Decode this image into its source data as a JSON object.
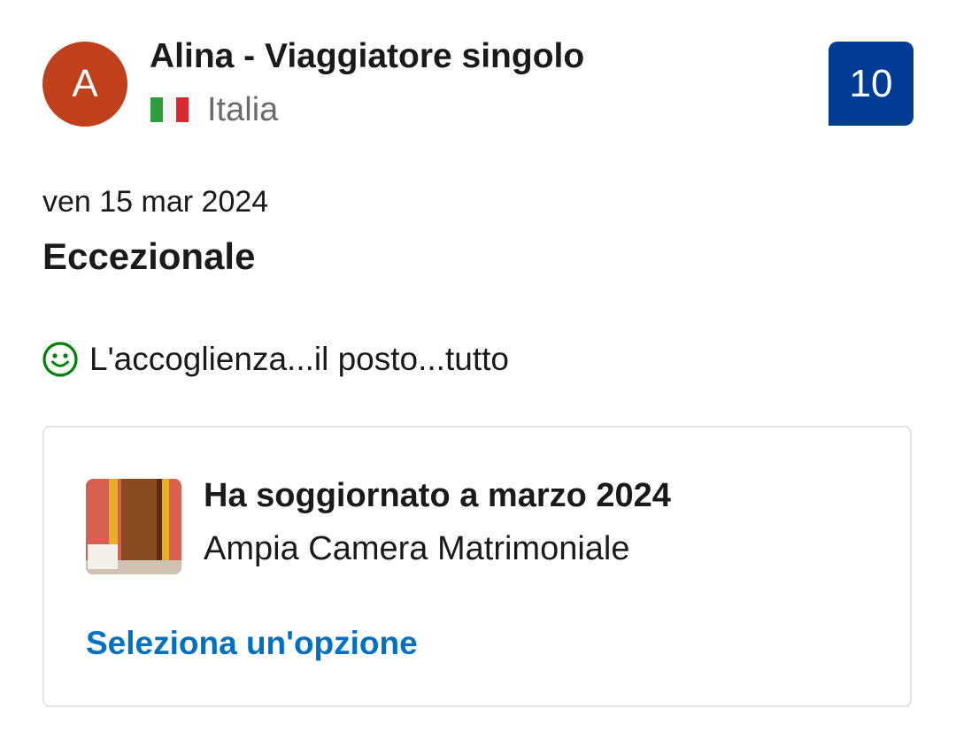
{
  "reviewer": {
    "avatar_initial": "A",
    "avatar_color": "#c0401c",
    "name": "Alina - Viaggiatore singolo",
    "country": "Italia",
    "flag_icon": "italy-flag-icon"
  },
  "score": {
    "value": "10",
    "color": "#003b95"
  },
  "review": {
    "date": "ven 15 mar 2024",
    "title": "Eccezionale",
    "positive_icon": "smile-icon",
    "positive_text": "L'accoglienza...il posto...tutto"
  },
  "stay": {
    "title": "Ha soggiornato a marzo 2024",
    "room": "Ampia Camera Matrimoniale",
    "select_link": "Seleziona un'opzione",
    "link_color": "#0071c2"
  }
}
